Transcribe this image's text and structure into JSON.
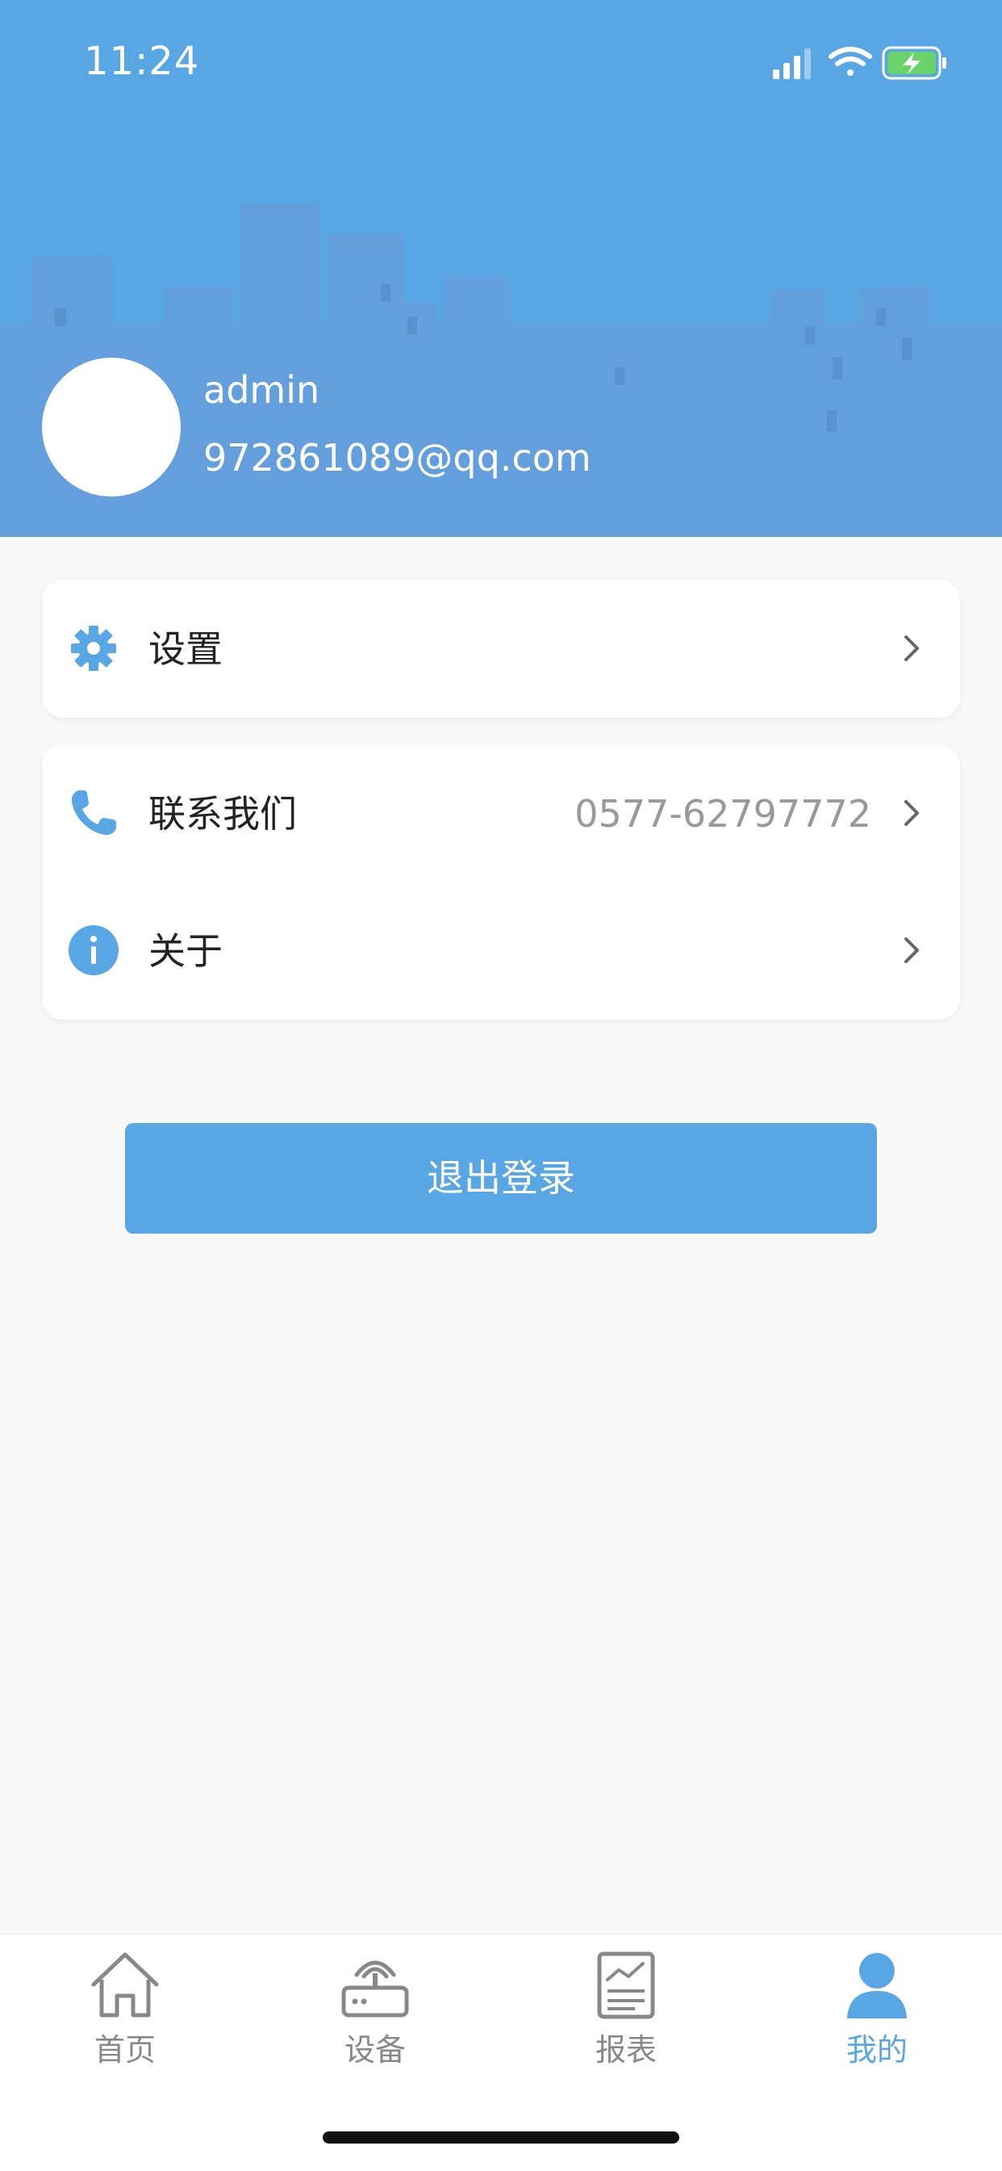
{
  "status_bar": {
    "time": "11:24"
  },
  "profile": {
    "username": "admin",
    "email": "972861089@qq.com"
  },
  "menu": {
    "settings": {
      "label": "设置",
      "icon": "gear-icon"
    },
    "contact": {
      "label": "联系我们",
      "value": "0577-62797772",
      "icon": "phone-icon"
    },
    "about": {
      "label": "关于",
      "icon": "info-icon"
    }
  },
  "logout_label": "退出登录",
  "tabs": [
    {
      "label": "首页",
      "icon": "home-icon",
      "active": false
    },
    {
      "label": "设备",
      "icon": "router-icon",
      "active": false
    },
    {
      "label": "报表",
      "icon": "report-icon",
      "active": false
    },
    {
      "label": "我的",
      "icon": "user-icon",
      "active": true
    }
  ],
  "colors": {
    "primary": "#58a7e4",
    "skyline": "#5f9fdc",
    "background": "#f8f8f8",
    "tab_inactive": "#888888"
  }
}
